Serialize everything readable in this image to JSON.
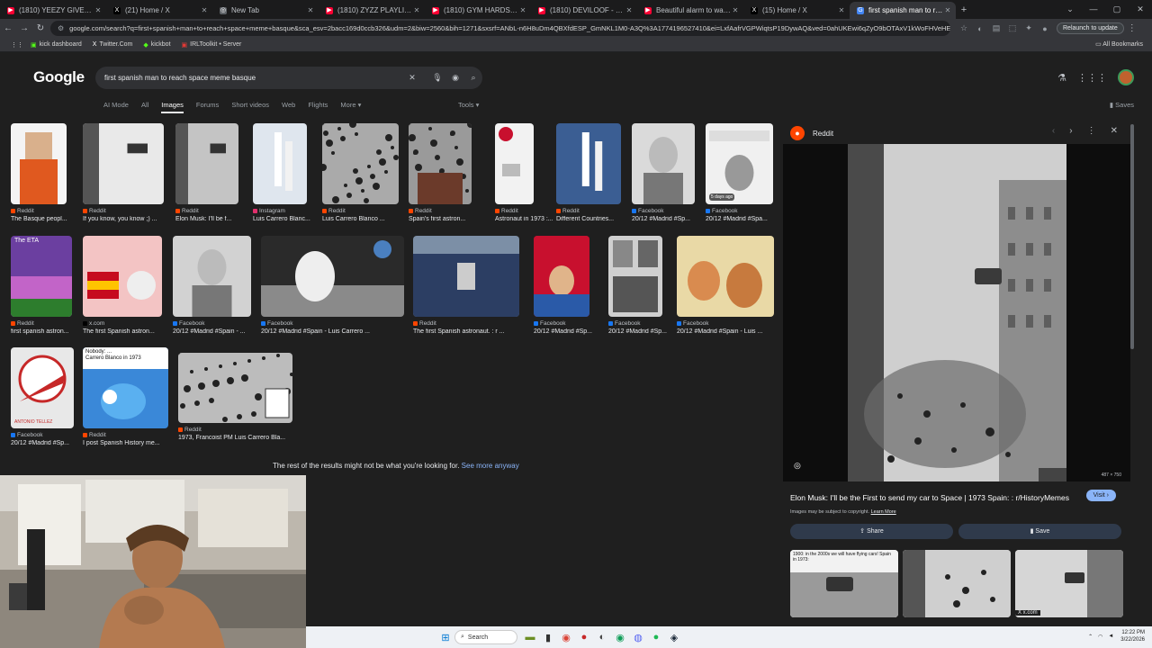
{
  "tabs": [
    {
      "title": "(1810) YEEZY GIVEAWAY!!! | 67",
      "fav_color": "#ff0033",
      "fav": "▶"
    },
    {
      "title": "(21) Home / X",
      "fav_color": "#000000",
      "fav": "X"
    },
    {
      "title": "New Tab",
      "fav_color": "#5f6368",
      "fav": "◎"
    },
    {
      "title": "(1810) ZYZZ PLAYLIST LEGEND",
      "fav_color": "#ff0033",
      "fav": "▶"
    },
    {
      "title": "(1810) GYM HARDSTYLE 😊 - ",
      "fav_color": "#ff0033",
      "fav": "▶"
    },
    {
      "title": "(1810) DEVILOOF - 揮發物/DE",
      "fav_color": "#ff0033",
      "fav": "▶"
    },
    {
      "title": "Beautiful alarm to wake up to",
      "fav_color": "#ff0033",
      "fav": "▶"
    },
    {
      "title": "(15) Home / X",
      "fav_color": "#000000",
      "fav": "X"
    },
    {
      "title": "first spanish man to reach spac",
      "fav_color": "#4285f4",
      "fav": "G"
    }
  ],
  "address": {
    "url": "google.com/search?q=first+spanish+man+to+reach+space+meme+basque&sca_esv=2bacc169d0ccb326&udm=2&biw=2560&bih=1271&sxsrf=ANbL-n6H8uDm4QBXfdESP_GmNKL1M0-A3Q%3A1774196527410&ei=LxfAafrVGPWiqtsP19DywAQ&ved=0ahUKEwi6qZyO9bOTAxV1kWoFHVeHEgQ4dUDCBI&uact=5&o...",
    "relaunch": "Relaunch to update"
  },
  "bookmarks": [
    {
      "label": "kick dashboard",
      "icon": "▣",
      "color": "#53fc18"
    },
    {
      "label": "Twitter.Com",
      "icon": "X",
      "color": "#ffffff"
    },
    {
      "label": "kickbot",
      "icon": "◆",
      "color": "#53fc18"
    },
    {
      "label": "IRLToolkit • Server",
      "icon": "▣",
      "color": "#e53935"
    }
  ],
  "all_bookmarks": "All Bookmarks",
  "google": {
    "logo": "Google",
    "query": "first spanish man to reach space meme basque"
  },
  "nav_tabs": [
    "AI Mode",
    "All",
    "Images",
    "Forums",
    "Short videos",
    "Web",
    "Flights",
    "More ▾"
  ],
  "tools": "Tools ▾",
  "saves": "Saves",
  "results": [
    {
      "source": "Reddit",
      "caption": "The Basque peopl..."
    },
    {
      "source": "Reddit",
      "caption": "If you know, you know ;) ..."
    },
    {
      "source": "Reddit",
      "caption": "Elon Musk: I'll be f..."
    },
    {
      "source": "Instagram",
      "caption": "Luis Carrero Blanc..."
    },
    {
      "source": "Reddit",
      "caption": "Luis Carrero Blanco ..."
    },
    {
      "source": "Reddit",
      "caption": "Spain's first astron..."
    },
    {
      "source": "Reddit",
      "caption": "Astronaut in 1973 :..."
    },
    {
      "source": "Reddit",
      "caption": "Different Countries..."
    },
    {
      "source": "Facebook",
      "caption": "20/12 #Madrid #Sp..."
    },
    {
      "source": "Facebook",
      "caption": "20/12 #Madrid #Spa..."
    },
    {
      "source": "Reddit",
      "caption": "first spanish astron..."
    },
    {
      "source": "x.com",
      "caption": "The first Spanish astron..."
    },
    {
      "source": "Facebook",
      "caption": "20/12 #Madrid #Spain - ..."
    },
    {
      "source": "Facebook",
      "caption": "20/12 #Madrid #Spain - Luis Carrero ..."
    },
    {
      "source": "Reddit",
      "caption": "The first Spanish astronaut. : r ..."
    },
    {
      "source": "Facebook",
      "caption": "20/12 #Madrid #Sp..."
    },
    {
      "source": "Facebook",
      "caption": "20/12 #Madrid #Sp..."
    },
    {
      "source": "Facebook",
      "caption": "20/12 #Madrid #Spain - Luis ..."
    },
    {
      "source": "Facebook",
      "caption": "20/12 #Madrid #Sp..."
    },
    {
      "source": "Reddit",
      "caption": "I post Spanish History me..."
    },
    {
      "source": "Reddit",
      "caption": "1973, Francoist PM Luis Carrero Bla..."
    }
  ],
  "thumb_text": {
    "eta": "The ETA",
    "nobody": "Nobody: ...\nCarrero Blanco in 1973",
    "days_ago": "5 days ago",
    "antonio": "ANTONIO TELLEZ"
  },
  "rest_text": "The rest of the results might not be what you're looking for.",
  "see_more": "See more anyway",
  "panel": {
    "source": "Reddit",
    "title": "Elon Musk: I'll be the First to send my car to Space | 1973 Spain: : r/HistoryMemes",
    "visit": "Visit",
    "copyright": "Images may be subject to copyright.",
    "learn_more": "Learn More",
    "share": "Share",
    "save": "Save",
    "dims": "487 × 750",
    "related_source": "x.com",
    "related_caption": "1900: in the 2000s we will have flying cars! Spain in 1973:"
  },
  "taskbar": {
    "search": "Search",
    "time": "12:22 PM",
    "date": "3/22/2026"
  }
}
